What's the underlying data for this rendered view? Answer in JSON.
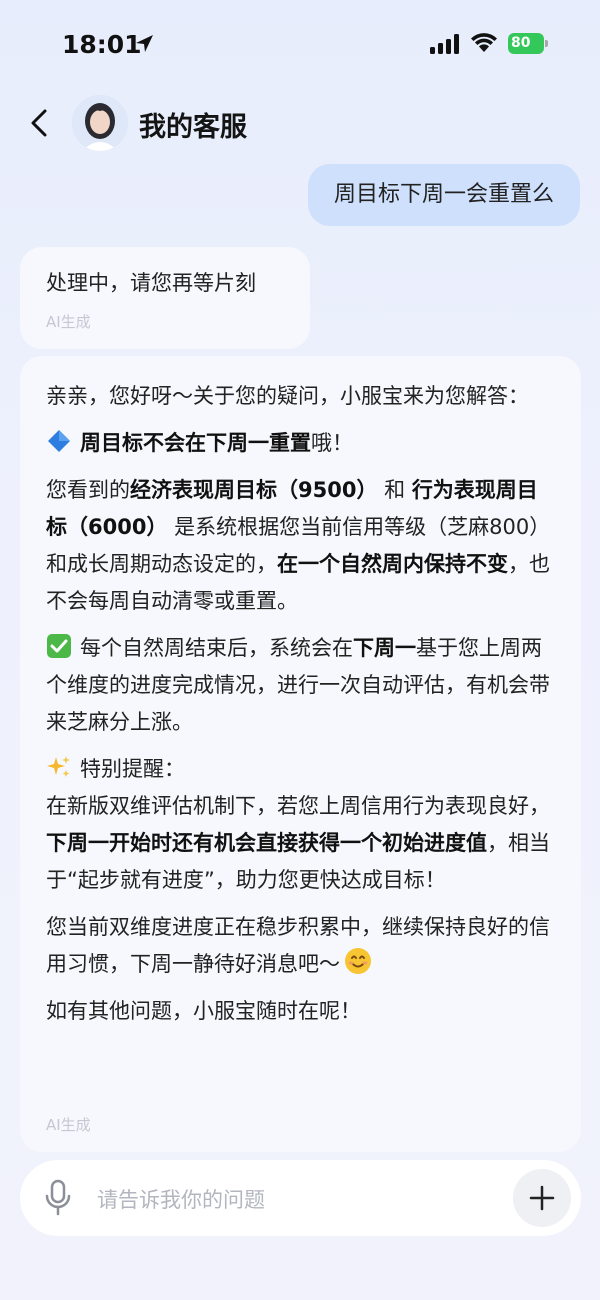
{
  "status_bar": {
    "time": "18:01",
    "battery": "80"
  },
  "header": {
    "title": "我的客服",
    "avatar": "customer-service-avatar"
  },
  "conversation": {
    "user_message": "周目标下周一会重置么",
    "ai_message_1": {
      "text": "处理中，请您再等片刻",
      "tag": "AI生成"
    },
    "ai_message_2": {
      "intro": "亲亲，您好呀～关于您的疑问，小服宝来为您解答：",
      "headline": "周目标不会在下周一重置",
      "headline_suffix": "哦！",
      "p2_a": "您看到的",
      "p2_b": "经济表现周目标（9500）",
      "p2_c": " 和 ",
      "p2_d": "行为表现周目标（6000）",
      "p2_e": " 是系统根据您当前信用等级（芝麻800）和成长周期动态设定的，",
      "p2_f": "在一个自然周内保持不变",
      "p2_g": "，也不会每周自动清零或重置。",
      "p3_a": "每个自然周结束后，系统会在",
      "p3_b": "下周一",
      "p3_c": "基于您上周两个维度的进度完成情况，进行一次自动评估，有机会带来芝麻分上涨。",
      "p4_title": "特别提醒：",
      "p4_a": "在新版双维评估机制下，若您上周信用行为表现良好，",
      "p4_b": "下周一开始时还有机会直接获得一个初始进度值",
      "p4_c": "，相当于“起步就有进度”，助力您更快达成目标！",
      "p5": "您当前双维度进度正在稳步积累中，继续保持良好的信用习惯，下周一静待好消息吧～",
      "p6": "如有其他问题，小服宝随时在呢！",
      "tag": "AI生成"
    }
  },
  "input": {
    "placeholder": "请告诉我你的问题"
  },
  "colors": {
    "user_bubble": "#cfe0fc",
    "ai_bubble": "#f7f8fd",
    "battery": "#34c759"
  }
}
